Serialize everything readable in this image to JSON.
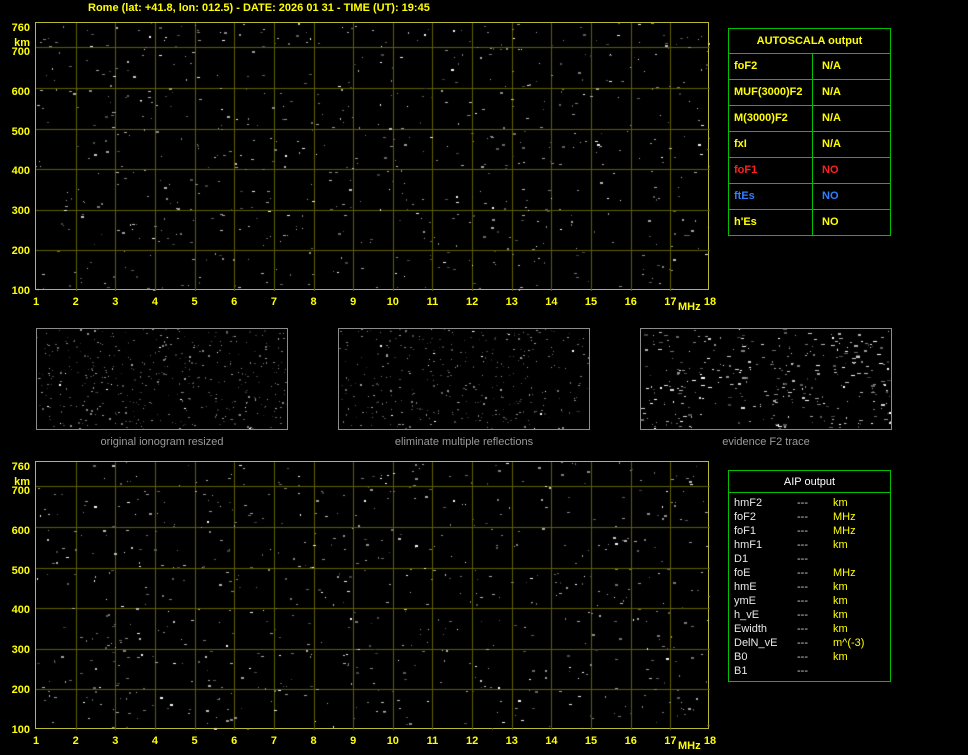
{
  "header": {
    "title": "Rome (lat: +41.8, lon: 012.5) - DATE: 2026 01 31 - TIME (UT): 19:45"
  },
  "colors": {
    "background": "#000000",
    "title_text": "#ffff00",
    "plot_border": "#b8b832",
    "grid": "#5e5e00",
    "axis_text": "#ffff00",
    "table_border": "#00c000",
    "value_yellow": "#ffff00",
    "value_red": "#ff2020",
    "value_blue": "#2f7fff",
    "aip_text": "#e8e8e8",
    "aip_unit": "#ffff00",
    "thumb_border": "#8c8c8c",
    "caption_text": "#9a9a9a"
  },
  "ionogram": {
    "x_unit": "MHz",
    "y_unit": "km",
    "x_range": [
      1,
      18
    ],
    "y_range": [
      100,
      760
    ],
    "x_ticks": [
      1,
      2,
      3,
      4,
      5,
      6,
      7,
      8,
      9,
      10,
      11,
      12,
      13,
      14,
      15,
      16,
      17,
      18
    ],
    "y_ticks": [
      760,
      700,
      600,
      500,
      400,
      300,
      200,
      100
    ]
  },
  "autoscala": {
    "header": "AUTOSCALA output",
    "rows": [
      {
        "label": "foF2",
        "value": "N/A",
        "color": "#ffff00"
      },
      {
        "label": "MUF(3000)F2",
        "value": "N/A",
        "color": "#ffff00"
      },
      {
        "label": "M(3000)F2",
        "value": "N/A",
        "color": "#ffff00"
      },
      {
        "label": "fxI",
        "value": "N/A",
        "color": "#ffff00"
      },
      {
        "label": "foF1",
        "value": "NO",
        "color": "#ff2020"
      },
      {
        "label": "ftEs",
        "value": "NO",
        "color": "#2f7fff"
      },
      {
        "label": "h'Es",
        "value": "NO",
        "color": "#ffff00"
      }
    ]
  },
  "thumbnails": [
    {
      "caption": "original ionogram resized",
      "noise": {
        "seed": 101,
        "count": 430,
        "min_v": 35,
        "max_v": 165,
        "max_size": 2,
        "bright": 0.03
      }
    },
    {
      "caption": "eliminate multiple reflections",
      "noise": {
        "seed": 202,
        "count": 360,
        "min_v": 35,
        "max_v": 165,
        "max_size": 2,
        "bright": 0.03
      }
    },
    {
      "caption": "evidence F2 trace",
      "noise": {
        "seed": 303,
        "count": 330,
        "min_v": 60,
        "max_v": 230,
        "max_size": 4,
        "bright": 0.18
      }
    }
  ],
  "aip": {
    "header": "AIP output",
    "rows": [
      {
        "label": "hmF2",
        "value": "---",
        "unit": "km"
      },
      {
        "label": "foF2",
        "value": "---",
        "unit": "MHz"
      },
      {
        "label": "foF1",
        "value": "---",
        "unit": "MHz"
      },
      {
        "label": "hmF1",
        "value": "---",
        "unit": "km"
      },
      {
        "label": "D1",
        "value": "---",
        "unit": ""
      },
      {
        "label": "foE",
        "value": "---",
        "unit": "MHz"
      },
      {
        "label": "hmE",
        "value": "---",
        "unit": "km"
      },
      {
        "label": "ymE",
        "value": "---",
        "unit": "km"
      },
      {
        "label": "h_vE",
        "value": "---",
        "unit": "km"
      },
      {
        "label": "Ewidth",
        "value": "---",
        "unit": "km"
      },
      {
        "label": "DelN_vE",
        "value": "---",
        "unit": "m^(-3)"
      },
      {
        "label": "B0",
        "value": "---",
        "unit": "km"
      },
      {
        "label": "B1",
        "value": "---",
        "unit": ""
      }
    ]
  },
  "noise": {
    "plot_top": {
      "seed": 7,
      "count": 700
    },
    "plot_bottom": {
      "seed": 19,
      "count": 700
    }
  }
}
